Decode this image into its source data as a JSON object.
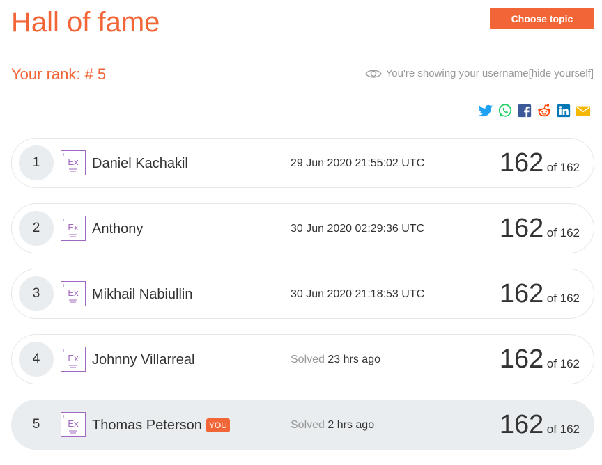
{
  "header": {
    "title": "Hall of fame",
    "choose_topic_label": "Choose topic"
  },
  "rank": {
    "label": "Your rank: # 5"
  },
  "visibility": {
    "text": "You're showing your username ",
    "hide_link": "[hide yourself]"
  },
  "share": [
    {
      "name": "twitter",
      "color": "#1da1f2"
    },
    {
      "name": "whatsapp",
      "color": "#25d366"
    },
    {
      "name": "facebook",
      "color": "#3b5998"
    },
    {
      "name": "reddit",
      "color": "#ff4500"
    },
    {
      "name": "linkedin",
      "color": "#0077b5"
    },
    {
      "name": "email",
      "color": "#f5b800"
    }
  ],
  "leaderboard": [
    {
      "rank": "1",
      "avatar_text": "Ex",
      "name": "Daniel Kachakil",
      "you": "",
      "time_prefix": "",
      "time": "29 Jun 2020 21:55:02 UTC",
      "score": "162",
      "total": "of 162"
    },
    {
      "rank": "2",
      "avatar_text": "Ex",
      "name": "Anthony",
      "you": "",
      "time_prefix": "",
      "time": "30 Jun 2020 02:29:36 UTC",
      "score": "162",
      "total": "of 162"
    },
    {
      "rank": "3",
      "avatar_text": "Ex",
      "name": "Mikhail Nabiullin",
      "you": "",
      "time_prefix": "",
      "time": "30 Jun 2020 21:18:53 UTC",
      "score": "162",
      "total": "of 162"
    },
    {
      "rank": "4",
      "avatar_text": "Ex",
      "name": "Johnny Villarreal",
      "you": "",
      "time_prefix": "Solved",
      "time": "23 hrs ago",
      "score": "162",
      "total": "of 162"
    },
    {
      "rank": "5",
      "avatar_text": "Ex",
      "name": "Thomas Peterson",
      "you": "YOU",
      "time_prefix": "Solved",
      "time": "2 hrs ago",
      "score": "162",
      "total": "of 162"
    }
  ],
  "colors": {
    "accent": "#f26536",
    "row_current": "#e9edef",
    "avatar": "#a068c0"
  }
}
